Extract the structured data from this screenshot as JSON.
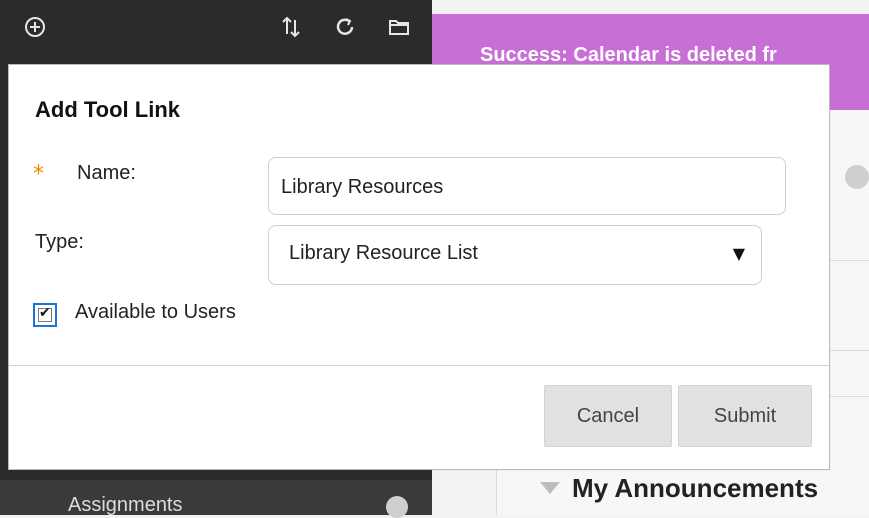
{
  "sidebar": {
    "top_icons": [
      "add-circle-icon",
      "sort-arrows-icon",
      "refresh-icon",
      "folder-icon"
    ],
    "visible_item": {
      "label": "Assignments"
    }
  },
  "banner": {
    "text": "Success: Calendar is deleted fr"
  },
  "dialog": {
    "title": "Add Tool Link",
    "required_marker": "*",
    "name_label": "Name:",
    "name_value": "Library Resources",
    "type_label": "Type:",
    "type_value": "Library Resource List",
    "select_arrow": "▼",
    "available_label": "Available to Users",
    "available_checked": true,
    "cancel_label": "Cancel",
    "submit_label": "Submit"
  },
  "announcements": {
    "title": "My Announcements"
  },
  "colors": {
    "sidebar_bg": "#2b2b2b",
    "banner_bg": "#c86fd6",
    "required": "#f08a00",
    "checkbox_focus": "#1e73d8",
    "button_bg": "#e1e1e1"
  }
}
